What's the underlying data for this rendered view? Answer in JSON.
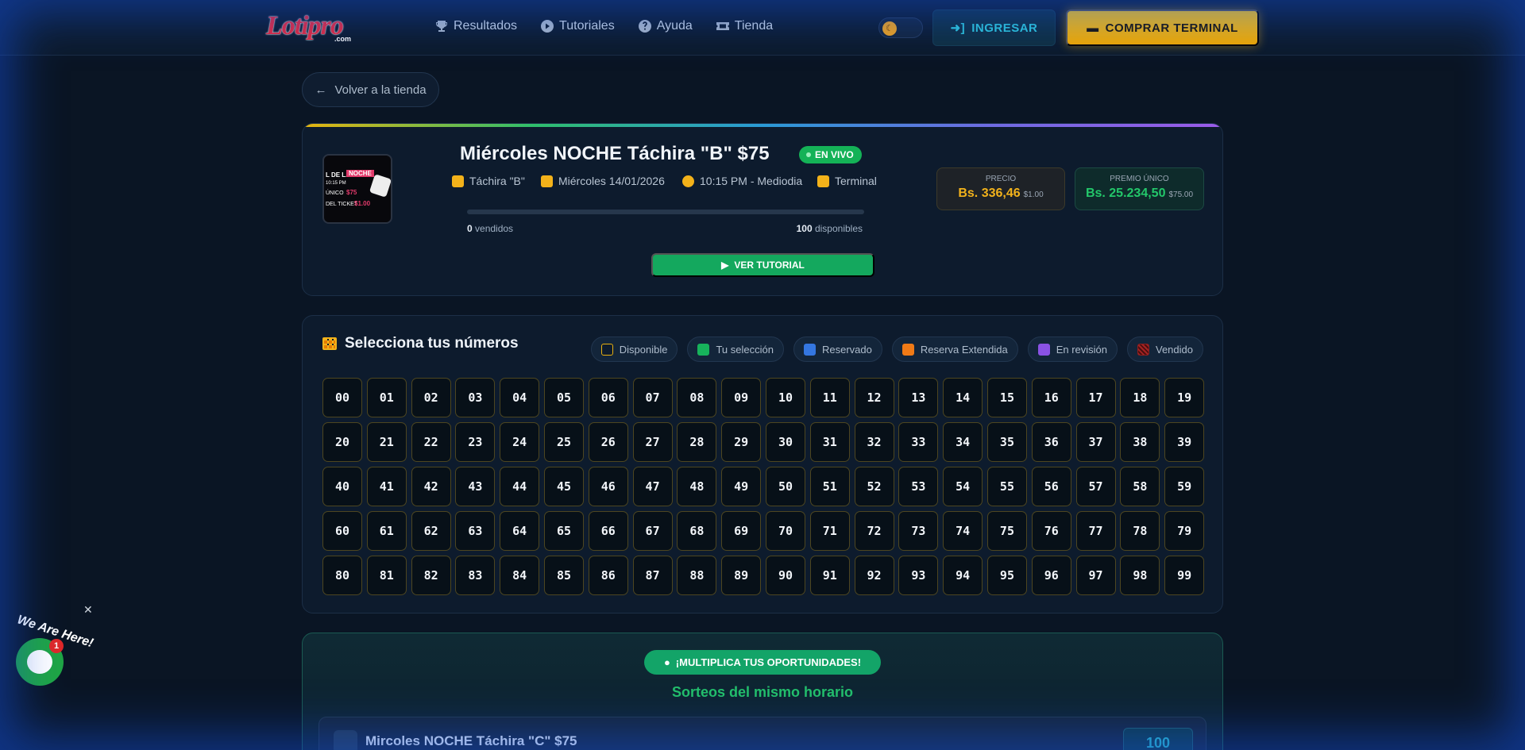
{
  "nav": {
    "logo": "Lotipro",
    "logo_sub": ".com",
    "links": [
      {
        "label": "Resultados",
        "icon": "trophy-icon"
      },
      {
        "label": "Tutoriales",
        "icon": "play-circle-icon"
      },
      {
        "label": "Ayuda",
        "icon": "help-circle-icon"
      },
      {
        "label": "Tienda",
        "icon": "ticket-icon"
      }
    ],
    "login_label": "INGRESAR",
    "buy_label": "COMPRAR TERMINAL"
  },
  "back_label": "Volver a la tienda",
  "draw": {
    "title": "Miércoles NOCHE Táchira \"B\" $75",
    "live_label": "EN VIVO",
    "meta": [
      {
        "icon": "coins-icon",
        "text": "Táchira \"B\""
      },
      {
        "icon": "calendar-icon",
        "text": "Miércoles 14/01/2026"
      },
      {
        "icon": "clock-icon",
        "text": "10:15 PM - Mediodia"
      },
      {
        "icon": "tag-icon",
        "text": "Terminal"
      }
    ],
    "progress_fraction": 0,
    "sold_count": "0",
    "sold_label": " vendidos",
    "available_count": "100",
    "available_label": " disponibles",
    "tutorial_label": "VER TUTORIAL",
    "price_label": "PRECIO",
    "price_value": "Bs. 336,46",
    "price_usd": "$1.00",
    "prize_label": "PREMIO ÚNICO",
    "prize_value": "Bs. 25.234,50",
    "prize_usd": "$75.00",
    "thumb": {
      "line1a": "L DE LA",
      "line1b": "NOCHE",
      "line2": "10:15 PM",
      "line3a": "ÚNICO",
      "line3b": "$75",
      "line3c": "USD",
      "line4a": "DEL TICKET",
      "line4b": "$1.00"
    }
  },
  "numbers": {
    "title": "Selecciona tus números",
    "legend": [
      {
        "label": "Disponible",
        "color": "#0d1b2d",
        "border": "#e8b00f"
      },
      {
        "label": "Tu selección",
        "color": "#17b25b",
        "border": "#17b25b"
      },
      {
        "label": "Reservado",
        "color": "#3476e0",
        "border": "#3476e0"
      },
      {
        "label": "Reserva Extendida",
        "color": "#f07a16",
        "border": "#f07a16"
      },
      {
        "label": "En revisión",
        "color": "#8a52e4",
        "border": "#8a52e4"
      },
      {
        "label": "Vendido",
        "color": "#8c1e1e",
        "border": "#8c1e1e"
      }
    ],
    "items": [
      "00",
      "01",
      "02",
      "03",
      "04",
      "05",
      "06",
      "07",
      "08",
      "09",
      "10",
      "11",
      "12",
      "13",
      "14",
      "15",
      "16",
      "17",
      "18",
      "19",
      "20",
      "21",
      "22",
      "23",
      "24",
      "25",
      "26",
      "27",
      "28",
      "29",
      "30",
      "31",
      "32",
      "33",
      "34",
      "35",
      "36",
      "37",
      "38",
      "39",
      "40",
      "41",
      "42",
      "43",
      "44",
      "45",
      "46",
      "47",
      "48",
      "49",
      "50",
      "51",
      "52",
      "53",
      "54",
      "55",
      "56",
      "57",
      "58",
      "59",
      "60",
      "61",
      "62",
      "63",
      "64",
      "65",
      "66",
      "67",
      "68",
      "69",
      "70",
      "71",
      "72",
      "73",
      "74",
      "75",
      "76",
      "77",
      "78",
      "79",
      "80",
      "81",
      "82",
      "83",
      "84",
      "85",
      "86",
      "87",
      "88",
      "89",
      "90",
      "91",
      "92",
      "93",
      "94",
      "95",
      "96",
      "97",
      "98",
      "99"
    ]
  },
  "multiply": {
    "badge": "¡MULTIPLICA TUS OPORTUNIDADES!",
    "title": "Sorteos del mismo horario",
    "related": [
      {
        "title": "Mircoles NOCHE Táchira \"C\" $75",
        "count": "100"
      }
    ]
  },
  "chat": {
    "label": "We Are Here!",
    "badge": "1"
  },
  "colors": {
    "accent_gold": "#f2b21b",
    "accent_green": "#14b257",
    "accent_cyan": "#2fc6d7",
    "background": "#0a1524"
  }
}
